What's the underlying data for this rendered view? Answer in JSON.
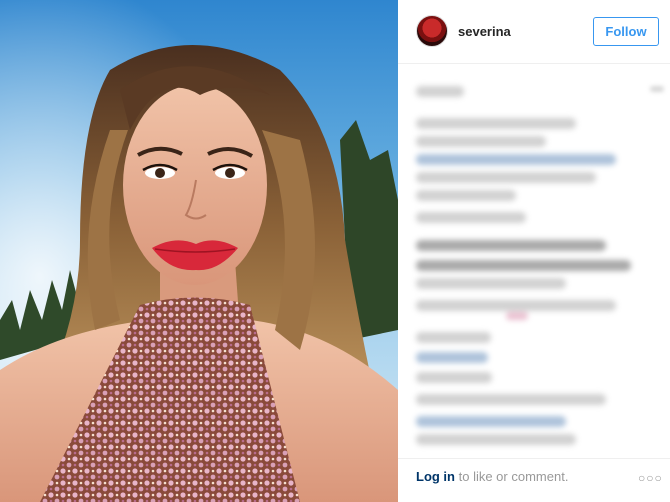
{
  "post": {
    "username": "severina",
    "follow_label": "Follow"
  },
  "footer": {
    "login_label": "Log in",
    "login_suffix": " to like or comment.",
    "more_glyph": "○○○"
  },
  "colors": {
    "accent": "#3897f0",
    "link": "#003569",
    "sky": "#4a9ad8",
    "lips": "#d8283a"
  },
  "icons": {
    "more": "more-options-icon"
  }
}
